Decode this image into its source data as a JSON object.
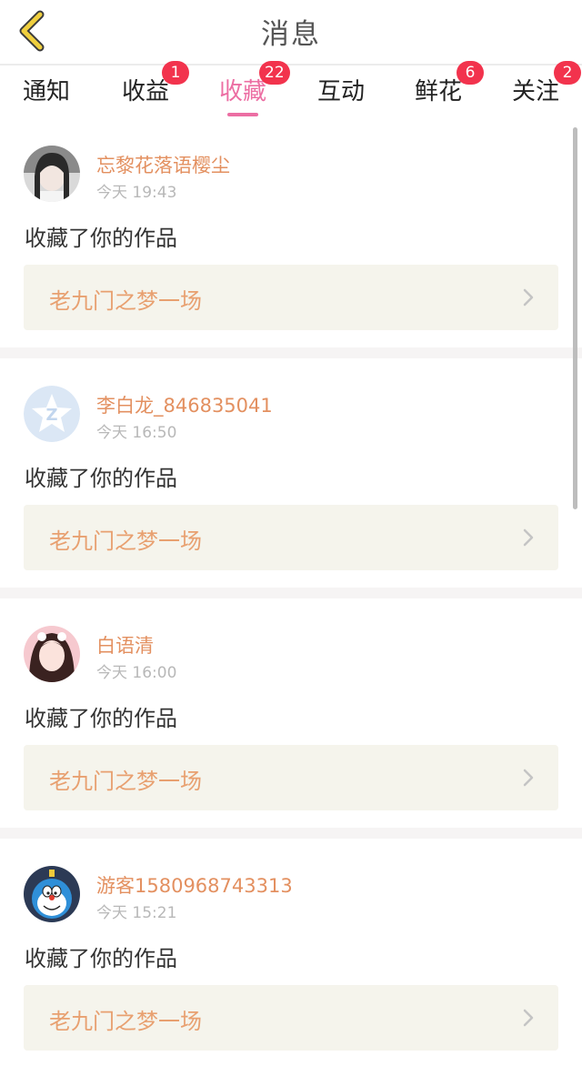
{
  "header": {
    "title": "消息",
    "back_icon": "chevron-left-icon",
    "accent_color": "#ec6ea3"
  },
  "tabs": [
    {
      "label": "通知",
      "badge": "",
      "active": false
    },
    {
      "label": "收益",
      "badge": "1",
      "active": false
    },
    {
      "label": "收藏",
      "badge": "22",
      "active": true
    },
    {
      "label": "互动",
      "badge": "",
      "active": false
    },
    {
      "label": "鲜花",
      "badge": "6",
      "active": false
    },
    {
      "label": "关注",
      "badge": "2",
      "active": false
    }
  ],
  "badge_color": "#f2334d",
  "messages": [
    {
      "username": "忘黎花落语樱尘",
      "time": "今天 19:43",
      "action": "收藏了你的作品",
      "work_title": "老九门之梦一场",
      "avatar": "girl-photo-avatar"
    },
    {
      "username": "李白龙_846835041",
      "time": "今天 16:50",
      "action": "收藏了你的作品",
      "work_title": "老九门之梦一场",
      "avatar": "default-z-avatar"
    },
    {
      "username": "白语清",
      "time": "今天 16:00",
      "action": "收藏了你的作品",
      "work_title": "老九门之梦一场",
      "avatar": "girl-pink-avatar"
    },
    {
      "username": "游客1580968743313",
      "time": "今天 15:21",
      "action": "收藏了你的作品",
      "work_title": "老九门之梦一场",
      "avatar": "doraemon-avatar"
    }
  ]
}
